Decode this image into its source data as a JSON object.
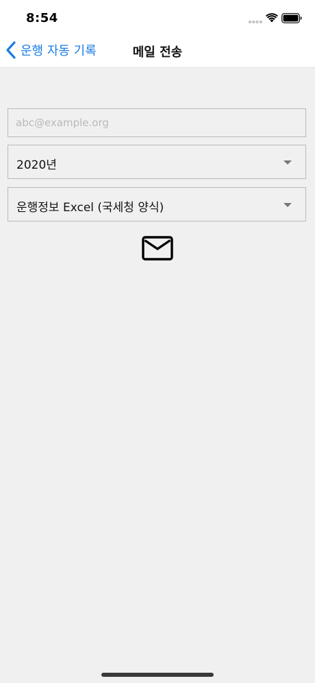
{
  "status_bar": {
    "time": "8:54",
    "icons": [
      "cellular-signal-icon",
      "wifi-icon",
      "battery-icon"
    ]
  },
  "nav": {
    "back_label": "운행 자동 기록",
    "title": "메일 전송"
  },
  "form": {
    "email": {
      "value": "",
      "placeholder": "abc@example.org"
    },
    "year_select": {
      "selected": "2020년"
    },
    "format_select": {
      "selected": "운행정보 Excel (국세청 양식)"
    },
    "send_icon": "mail-icon"
  },
  "colors": {
    "accent": "#1a7de3",
    "background": "#f0f0f0",
    "border": "#b8b8b8",
    "placeholder": "#b9b9b9"
  }
}
